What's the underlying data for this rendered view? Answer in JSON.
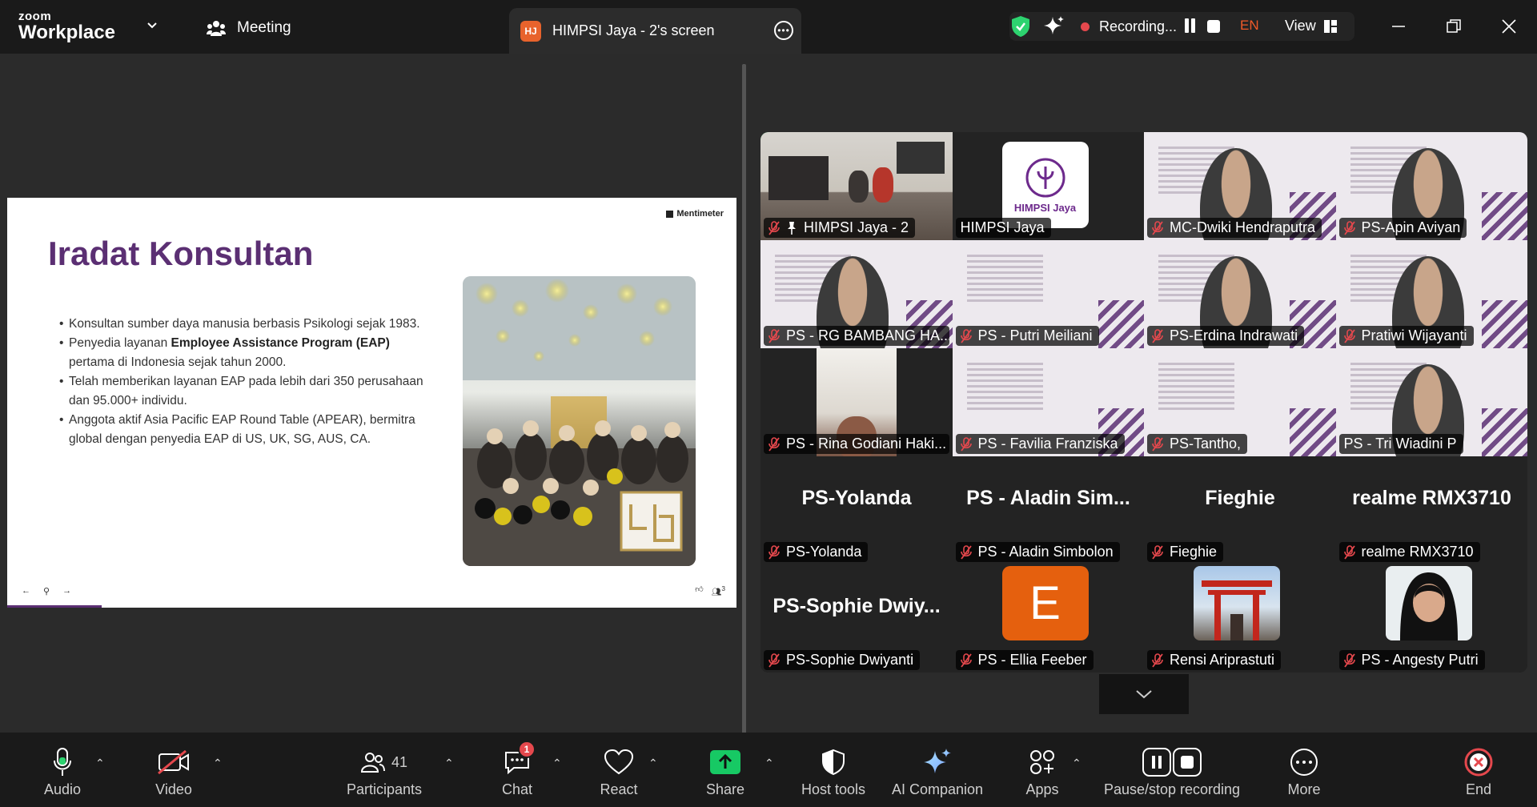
{
  "app": {
    "brand_small": "zoom",
    "brand_big": "Workplace"
  },
  "titlebar": {
    "meeting_label": "Meeting",
    "screen_tab_initials": "HJ",
    "screen_tab_label": "HIMPSI Jaya - 2's screen",
    "recording_label": "Recording...",
    "language": "EN",
    "view_label": "View"
  },
  "slide": {
    "brand": "Mentimeter",
    "title": "Iradat Konsultan",
    "bullets": [
      {
        "pre": "Konsultan sumber daya manusia berbasis Psikologi sejak 1983.",
        "bold": "",
        "post": ""
      },
      {
        "pre": "Penyedia layanan ",
        "bold": "Employee Assistance Program (EAP)",
        "post": " pertama di Indonesia sejak tahun 2000."
      },
      {
        "pre": "Telah memberikan layanan EAP pada lebih dari 350 perusahaan dan 95.000+ individu.",
        "bold": "",
        "post": ""
      },
      {
        "pre": "Anggota aktif Asia Pacific EAP Round Table (APEAR), bermitra global dengan penyedia EAP di US, UK, SG, AUS, CA.",
        "bold": "",
        "post": ""
      }
    ],
    "nav_prev": "←",
    "nav_pin": "⚲",
    "nav_next": "→",
    "reaction_count": "3"
  },
  "participants_grid": [
    {
      "name": "HIMPSI Jaya - 2",
      "kind": "room",
      "muted": true,
      "pinned": true,
      "active": true
    },
    {
      "name": "HIMPSI Jaya",
      "kind": "logo",
      "muted": false,
      "logo_text": "HIMPSI Jaya"
    },
    {
      "name": "MC-Dwiki Hendraputra",
      "kind": "poster-person",
      "muted": true
    },
    {
      "name": "PS-Apin Aviyan",
      "kind": "poster-person",
      "muted": true
    },
    {
      "name": "PS - RG BAMBANG HA...",
      "kind": "poster-person",
      "muted": true
    },
    {
      "name": "PS - Putri Meiliani",
      "kind": "poster",
      "muted": true
    },
    {
      "name": "PS-Erdina Indrawati",
      "kind": "poster-person",
      "muted": true
    },
    {
      "name": "Pratiwi Wijayanti",
      "kind": "poster-person",
      "muted": true
    },
    {
      "name": "PS - Rina Godiani Haki...",
      "kind": "camera",
      "muted": true
    },
    {
      "name": "PS - Favilia Franziska",
      "kind": "poster",
      "muted": true
    },
    {
      "name": "PS-Tantho,",
      "kind": "poster",
      "muted": true
    },
    {
      "name": "PS - Tri Wiadini P",
      "kind": "poster-person",
      "muted": false
    },
    {
      "name": "PS-Yolanda",
      "kind": "text",
      "display": "PS-Yolanda",
      "muted": true
    },
    {
      "name": "PS - Aladin Simbolon",
      "kind": "text",
      "display": "PS - Aladin Sim...",
      "muted": true
    },
    {
      "name": "Fieghie",
      "kind": "text",
      "display": "Fieghie",
      "muted": true
    },
    {
      "name": "realme RMX3710",
      "kind": "text",
      "display": "realme RMX3710",
      "muted": true
    },
    {
      "name": "PS-Sophie Dwiyanti",
      "kind": "text",
      "display": "PS-Sophie  Dwiy...",
      "muted": true
    },
    {
      "name": "PS - Ellia Feeber",
      "kind": "letter",
      "letter": "E",
      "muted": true
    },
    {
      "name": "Rensi Ariprastuti",
      "kind": "photo-torii",
      "muted": true
    },
    {
      "name": "PS - Angesty Putri",
      "kind": "photo-hijab",
      "muted": true
    }
  ],
  "toolbar": {
    "audio": "Audio",
    "video": "Video",
    "participants": "Participants",
    "participants_count": "41",
    "chat": "Chat",
    "chat_badge": "1",
    "react": "React",
    "share": "Share",
    "host_tools": "Host tools",
    "ai_companion": "AI Companion",
    "apps": "Apps",
    "pause_stop": "Pause/stop recording",
    "more": "More",
    "end": "End"
  },
  "colors": {
    "accent_green": "#2dd36f",
    "share_green": "#17c964",
    "record_red": "#e5484d",
    "brand_purple": "#5b2f73",
    "end_red": "#e5484d"
  }
}
